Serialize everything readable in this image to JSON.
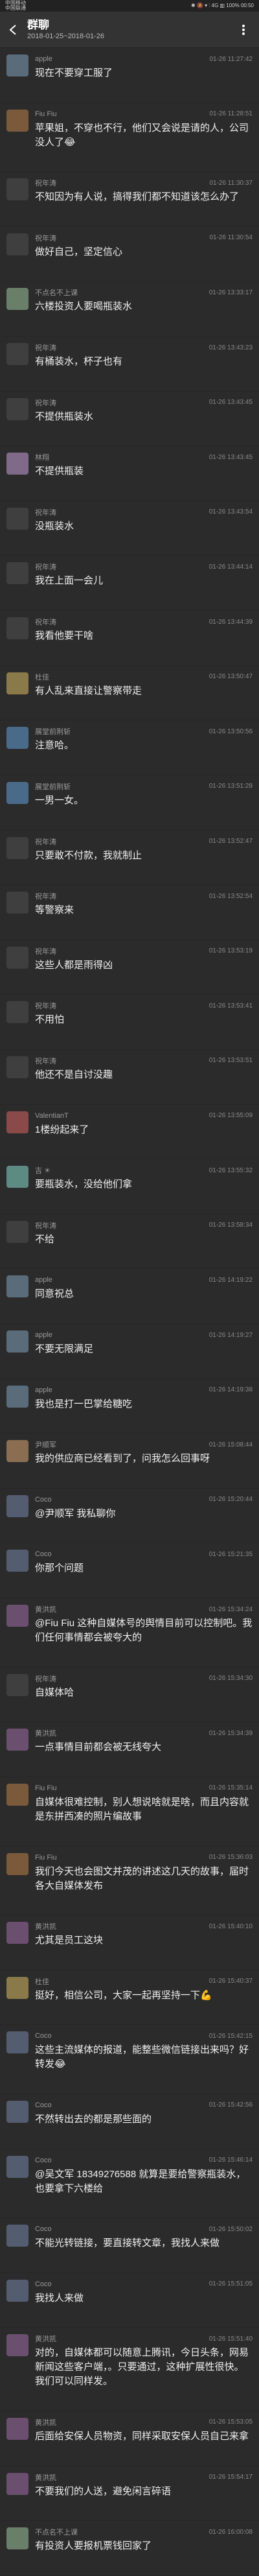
{
  "status_bar": {
    "left_line1": "中国移动",
    "left_line2": "中国联通",
    "right": "✱ 🔕 ▾ ⫶ 4G ▥ 100% 00:50"
  },
  "header": {
    "title": "群聊",
    "subtitle": "2018-01-25~2018-01-26",
    "back_icon": "back-arrow-icon",
    "more_icon": "more-vertical-icon"
  },
  "messages": [
    {
      "name": "apple",
      "time": "01-26 11:27:42",
      "text": "现在不要穿工服了"
    },
    {
      "name": "Fiu Fiu",
      "time": "01-26 11:28:51",
      "text": "苹果姐，不穿也不行，他们又会说是请的人，公司没人了😂"
    },
    {
      "name": "祝年涛",
      "time": "01-26 11:30:37",
      "text": "不知因为有人说，搞得我们都不知道该怎么办了"
    },
    {
      "name": "祝年涛",
      "time": "01-26 11:30:54",
      "text": "做好自己，坚定信心"
    },
    {
      "name": "不点名不上课",
      "time": "01-26 13:33:17",
      "text": "六楼投资人要喝瓶装水"
    },
    {
      "name": "祝年涛",
      "time": "01-26 13:43:23",
      "text": "有桶装水，杯子也有"
    },
    {
      "name": "祝年涛",
      "time": "01-26 13:43:45",
      "text": "不提供瓶装水"
    },
    {
      "name": "林翔",
      "time": "01-26 13:43:45",
      "text": "不提供瓶装"
    },
    {
      "name": "祝年涛",
      "time": "01-26 13:43:54",
      "text": "没瓶装水"
    },
    {
      "name": "祝年涛",
      "time": "01-26 13:44:14",
      "text": "我在上面一会儿"
    },
    {
      "name": "祝年涛",
      "time": "01-26 13:44:39",
      "text": "我看他要干啥"
    },
    {
      "name": "杜佳",
      "time": "01-26 13:50:47",
      "text": "有人乱来直接让警察带走"
    },
    {
      "name": "展堂前荆斩",
      "time": "01-26 13:50:56",
      "text": "注意哈。"
    },
    {
      "name": "展堂前荆斩",
      "time": "01-26 13:51:28",
      "text": "一男一女。"
    },
    {
      "name": "祝年涛",
      "time": "01-26 13:52:47",
      "text": "只要敢不付款，我就制止"
    },
    {
      "name": "祝年涛",
      "time": "01-26 13:52:54",
      "text": "等警察来"
    },
    {
      "name": "祝年涛",
      "time": "01-26 13:53:19",
      "text": "这些人都是雨得凶"
    },
    {
      "name": "祝年涛",
      "time": "01-26 13:53:41",
      "text": "不用怕"
    },
    {
      "name": "祝年涛",
      "time": "01-26 13:53:51",
      "text": "他还不是自讨没趣"
    },
    {
      "name": "ValentianT",
      "time": "01-26 13:55:09",
      "text": "1楼纷起来了"
    },
    {
      "name": "吉 ☀",
      "time": "01-26 13:55:32",
      "text": "要瓶装水，没给他们拿"
    },
    {
      "name": "祝年涛",
      "time": "01-26 13:58:34",
      "text": "不给"
    },
    {
      "name": "apple",
      "time": "01-26 14:19:22",
      "text": "同意祝总"
    },
    {
      "name": "apple",
      "time": "01-26 14:19:27",
      "text": "不要无限满足"
    },
    {
      "name": "apple",
      "time": "01-26 14:19:38",
      "text": "我也是打一巴掌给糖吃"
    },
    {
      "name": "尹顺军",
      "time": "01-26 15:08:44",
      "text": "我的供应商已经看到了，问我怎么回事呀"
    },
    {
      "name": "Coco",
      "time": "01-26 15:20:44",
      "text": "@尹顺军 我私聊你"
    },
    {
      "name": "Coco",
      "time": "01-26 15:21:35",
      "text": "你那个问题"
    },
    {
      "name": "黄洪凯",
      "time": "01-26 15:34:24",
      "text": "@Fiu Fiu 这种自媒体号的舆情目前可以控制吧。我们任何事情都会被夸大的"
    },
    {
      "name": "祝年涛",
      "time": "01-26 15:34:30",
      "text": "自媒体哈"
    },
    {
      "name": "黄洪凯",
      "time": "01-26 15:34:39",
      "text": "一点事情目前都会被无线夸大"
    },
    {
      "name": "Fiu Fiu",
      "time": "01-26 15:35:14",
      "text": "自媒体很难控制，别人想说啥就是啥，而且内容就是东拼西凑的照片编故事"
    },
    {
      "name": "Fiu Fiu",
      "time": "01-26 15:36:03",
      "text": "我们今天也会图文并茂的讲述这几天的故事，届时各大自媒体发布"
    },
    {
      "name": "黄洪凯",
      "time": "01-26 15:40:10",
      "text": "尤其是员工这块"
    },
    {
      "name": "杜佳",
      "time": "01-26 15:40:37",
      "text": "挺好，相信公司，大家一起再坚持一下💪"
    },
    {
      "name": "Coco",
      "time": "01-26 15:42:15",
      "text": "这些主流媒体的报道，能整些微信链接出来吗？好转发😂"
    },
    {
      "name": "Coco",
      "time": "01-26 15:42:56",
      "text": "不然转出去的都是那些面的"
    },
    {
      "name": "Coco",
      "time": "01-26 15:46:14",
      "text": "@吴文军 18349276588 就算是要给警察瓶装水，也要拿下六楼给"
    },
    {
      "name": "Coco",
      "time": "01-26 15:50:02",
      "text": "不能光转链接，要直接转文章，我找人来做"
    },
    {
      "name": "Coco",
      "time": "01-26 15:51:05",
      "text": "我找人来做"
    },
    {
      "name": "黄洪凯",
      "time": "01-26 15:51:40",
      "text": "对的，自媒体都可以随意上腾讯，今日头条，网易新闻这些客户端，。只要通过，这种扩展性很快。我们可以同样发。"
    },
    {
      "name": "黄洪凯",
      "time": "01-26 15:53:05",
      "text": "后面给安保人员物资，同样采取安保人员自己来拿"
    },
    {
      "name": "黄洪凯",
      "time": "01-26 15:54:17",
      "text": "不要我们的人送，避免闲言碎语"
    },
    {
      "name": "不点名不上课",
      "time": "01-26 16:00:08",
      "text": "有投资人要报机票钱回家了"
    }
  ]
}
